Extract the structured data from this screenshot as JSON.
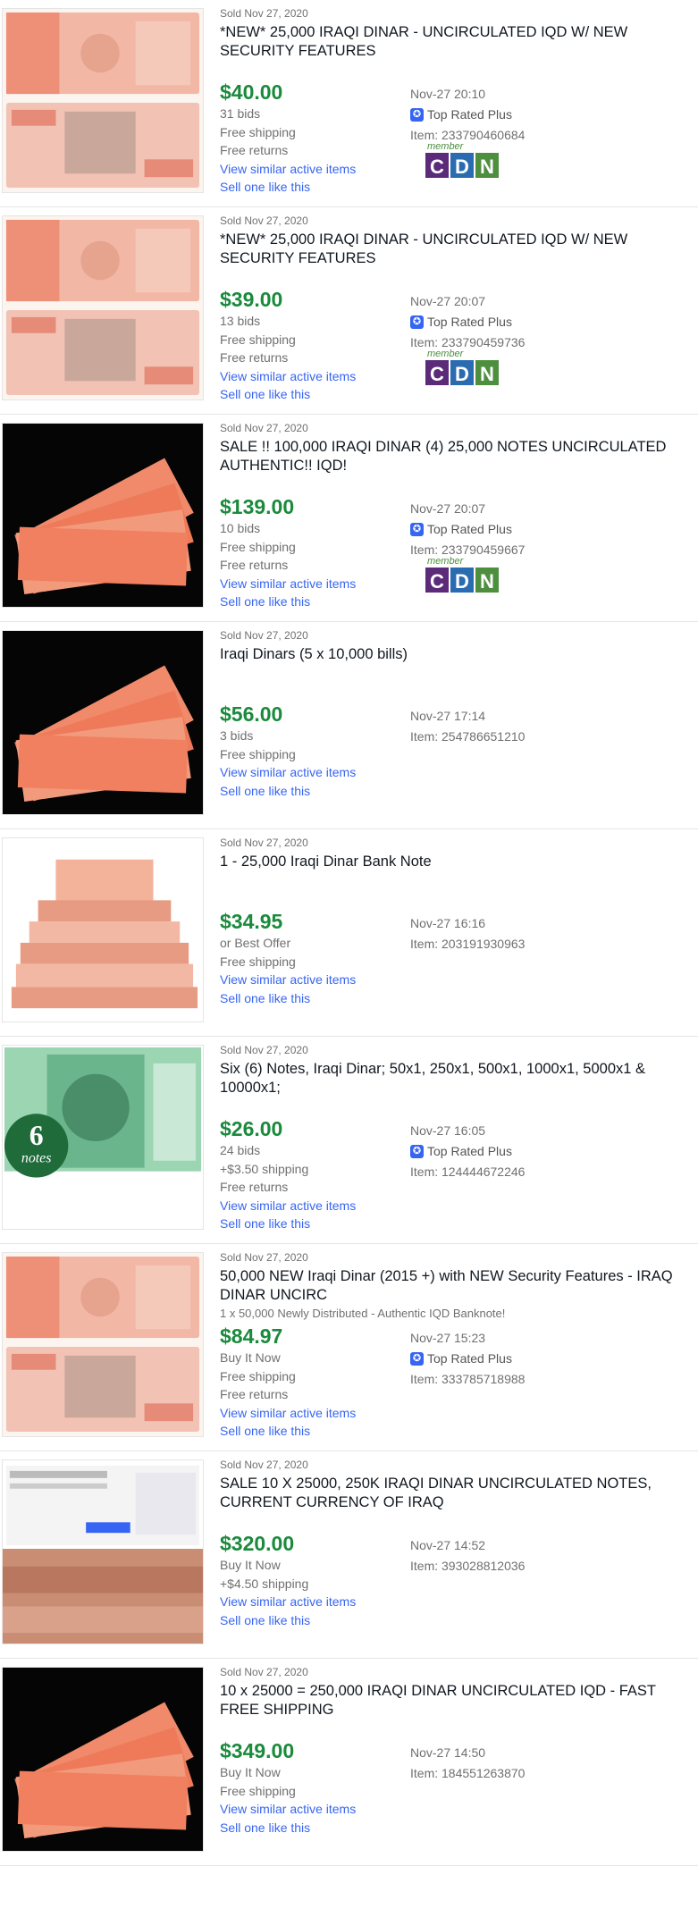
{
  "colors": {
    "price": "#1a8a3c",
    "link": "#3665f3",
    "secondary_text": "#707070",
    "title_text": "#111820",
    "top_rated_badge": "#3665f3"
  },
  "cdn_badge": {
    "member": "member",
    "letters": [
      "C",
      "D",
      "N"
    ]
  },
  "items": [
    {
      "sold": "Sold Nov 27, 2020",
      "title": "*NEW* 25,000 IRAQI DINAR - UNCIRCULATED IQD W/ NEW SECURITY FEATURES",
      "subtitle": "",
      "price": "$40.00",
      "details": [
        "31 bids",
        "Free shipping",
        "Free returns"
      ],
      "view_similar": "View similar active items",
      "sell_one": "Sell one like this",
      "time": "Nov-27 20:10",
      "top_rated": "Top Rated Plus",
      "item_number": "Item: 233790460684",
      "cdn": true,
      "thumb_icon": "banknote-image"
    },
    {
      "sold": "Sold Nov 27, 2020",
      "title": "*NEW* 25,000 IRAQI DINAR - UNCIRCULATED IQD W/ NEW SECURITY FEATURES",
      "subtitle": "",
      "price": "$39.00",
      "details": [
        "13 bids",
        "Free shipping",
        "Free returns"
      ],
      "view_similar": "View similar active items",
      "sell_one": "Sell one like this",
      "time": "Nov-27 20:07",
      "top_rated": "Top Rated Plus",
      "item_number": "Item: 233790459736",
      "cdn": true,
      "thumb_icon": "banknote-image"
    },
    {
      "sold": "Sold Nov 27, 2020",
      "title": "SALE !! 100,000 IRAQI DINAR (4) 25,000 NOTES UNCIRCULATED AUTHENTIC!! IQD!",
      "subtitle": "",
      "price": "$139.00",
      "details": [
        "10 bids",
        "Free shipping",
        "Free returns"
      ],
      "view_similar": "View similar active items",
      "sell_one": "Sell one like this",
      "time": "Nov-27 20:07",
      "top_rated": "Top Rated Plus",
      "item_number": "Item: 233790459667",
      "cdn": true,
      "thumb_icon": "fanned-notes-image"
    },
    {
      "sold": "Sold Nov 27, 2020",
      "title": "Iraqi Dinars (5 x 10,000 bills)",
      "subtitle": "",
      "price": "$56.00",
      "details": [
        "3 bids",
        "Free shipping"
      ],
      "view_similar": "View similar active items",
      "sell_one": "Sell one like this",
      "time": "Nov-27 17:14",
      "top_rated": "",
      "item_number": "Item: 254786651210",
      "cdn": false,
      "thumb_icon": "fanned-notes-image"
    },
    {
      "sold": "Sold Nov 27, 2020",
      "title": "1 - 25,000 Iraqi Dinar Bank Note",
      "subtitle": "",
      "price": "$34.95",
      "details": [
        "or Best Offer",
        "Free shipping"
      ],
      "view_similar": "View similar active items",
      "sell_one": "Sell one like this",
      "time": "Nov-27 16:16",
      "top_rated": "",
      "item_number": "Item: 203191930963",
      "cdn": false,
      "thumb_icon": "note-stack-image"
    },
    {
      "sold": "Sold Nov 27, 2020",
      "title": "Six (6) Notes, Iraqi Dinar; 50x1, 250x1, 500x1, 1000x1, 5000x1 & 10000x1;",
      "subtitle": "",
      "price": "$26.00",
      "details": [
        "24 bids",
        "+$3.50 shipping",
        "Free returns"
      ],
      "view_similar": "View similar active items",
      "sell_one": "Sell one like this",
      "time": "Nov-27 16:05",
      "top_rated": "Top Rated Plus",
      "item_number": "Item: 124444672246",
      "cdn": false,
      "thumb_icon": "green-note-image",
      "thumb_badge": {
        "number": "6",
        "word": "notes"
      }
    },
    {
      "sold": "Sold Nov 27, 2020",
      "title": "50,000 NEW Iraqi Dinar (2015 +) with NEW Security Features - IRAQ DINAR UNCIRC",
      "subtitle": "1 x 50,000 Newly Distributed - Authentic IQD Banknote!",
      "price": "$84.97",
      "details": [
        "Buy It Now",
        "Free shipping",
        "Free returns"
      ],
      "view_similar": "View similar active items",
      "sell_one": "Sell one like this",
      "time": "Nov-27 15:23",
      "top_rated": "Top Rated Plus",
      "item_number": "Item: 333785718988",
      "cdn": false,
      "thumb_icon": "banknote-image"
    },
    {
      "sold": "Sold Nov 27, 2020",
      "title": "SALE 10 X 25000, 250K IRAQI DINAR UNCIRCULATED NOTES, CURRENT CURRENCY OF IRAQ",
      "subtitle": "",
      "price": "$320.00",
      "details": [
        "Buy It Now",
        "+$4.50 shipping"
      ],
      "view_similar": "View similar active items",
      "sell_one": "Sell one like this",
      "time": "Nov-27 14:52",
      "top_rated": "",
      "item_number": "Item: 393028812036",
      "cdn": false,
      "thumb_icon": "listing-screenshot-image"
    },
    {
      "sold": "Sold Nov 27, 2020",
      "title": "10 x 25000 = 250,000 IRAQI DINAR UNCIRCULATED IQD - FAST FREE SHIPPING",
      "subtitle": "",
      "price": "$349.00",
      "details": [
        "Buy It Now",
        "Free shipping"
      ],
      "view_similar": "View similar active items",
      "sell_one": "Sell one like this",
      "time": "Nov-27 14:50",
      "top_rated": "",
      "item_number": "Item: 184551263870",
      "cdn": false,
      "thumb_icon": "fanned-notes-image"
    }
  ]
}
